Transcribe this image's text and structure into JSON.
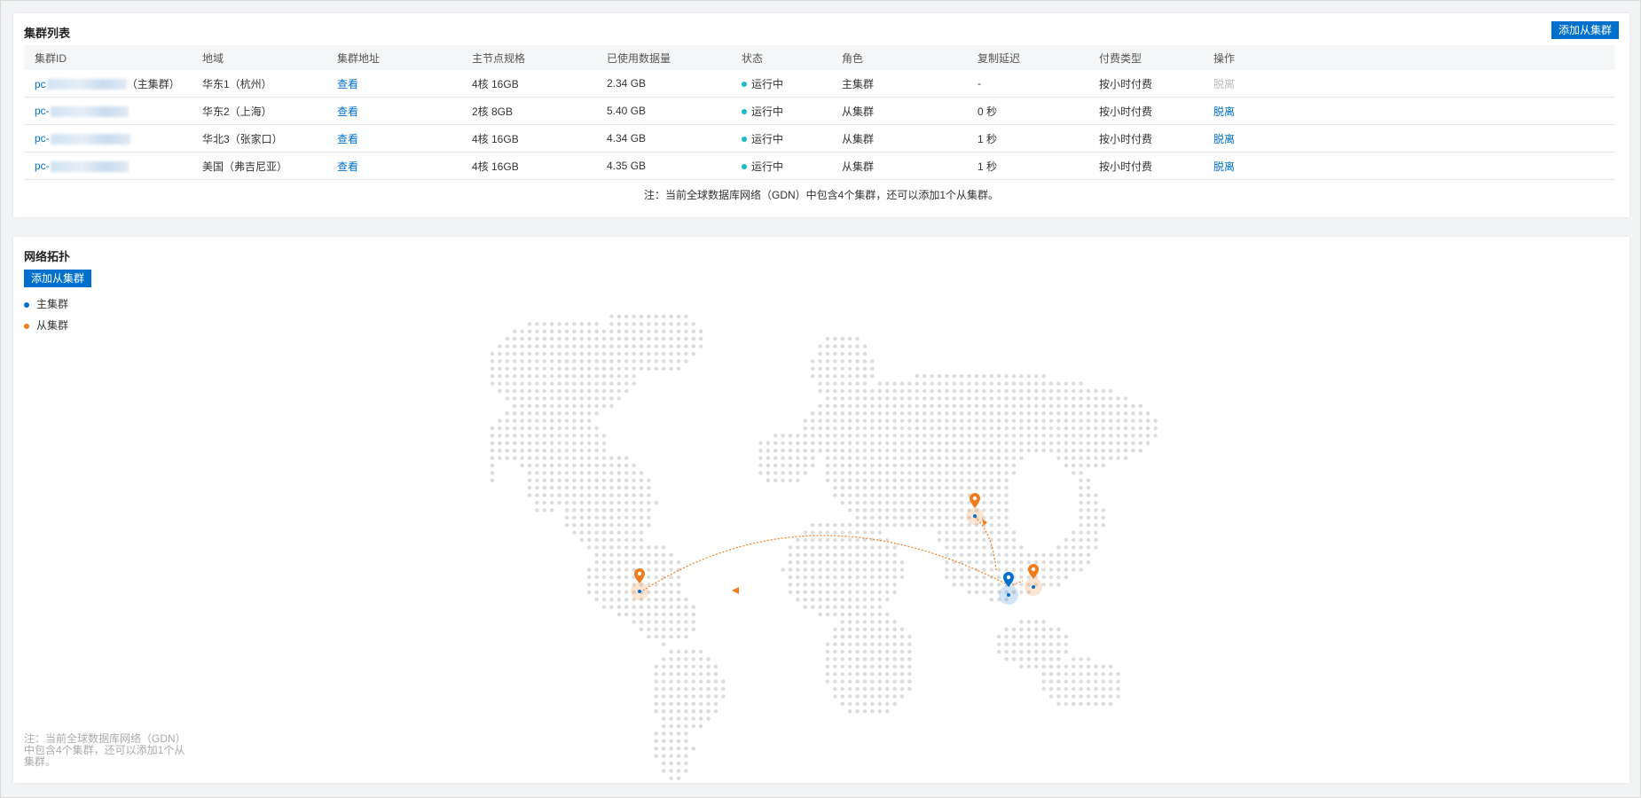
{
  "cluster_list": {
    "title": "集群列表",
    "add_button": "添加从集群",
    "columns": [
      "集群ID",
      "地域",
      "集群地址",
      "主节点规格",
      "已使用数据量",
      "状态",
      "角色",
      "复制延迟",
      "付费类型",
      "操作"
    ],
    "rows": [
      {
        "id_prefix": "pc",
        "id_suffix": "（主集群）",
        "region": "华东1（杭州）",
        "address": "查看",
        "spec": "4核 16GB",
        "data_used": "2.34 GB",
        "status": "运行中",
        "role": "主集群",
        "delay": "-",
        "billing": "按小时付费",
        "action": "脱离",
        "action_enabled": false
      },
      {
        "id_prefix": "pc-",
        "id_suffix": "",
        "region": "华东2（上海）",
        "address": "查看",
        "spec": "2核 8GB",
        "data_used": "5.40 GB",
        "status": "运行中",
        "role": "从集群",
        "delay": "0 秒",
        "billing": "按小时付费",
        "action": "脱离",
        "action_enabled": true
      },
      {
        "id_prefix": "pc-",
        "id_suffix": "",
        "region": "华北3（张家口）",
        "address": "查看",
        "spec": "4核 16GB",
        "data_used": "4.34 GB",
        "status": "运行中",
        "role": "从集群",
        "delay": "1 秒",
        "billing": "按小时付费",
        "action": "脱离",
        "action_enabled": true
      },
      {
        "id_prefix": "pc-",
        "id_suffix": "",
        "region": "美国（弗吉尼亚）",
        "address": "查看",
        "spec": "4核 16GB",
        "data_used": "4.35 GB",
        "status": "运行中",
        "role": "从集群",
        "delay": "1 秒",
        "billing": "按小时付费",
        "action": "脱离",
        "action_enabled": true
      }
    ],
    "note": "注：当前全球数据库网络（GDN）中包含4个集群，还可以添加1个从集群。"
  },
  "topology": {
    "title": "网络拓扑",
    "add_button": "添加从集群",
    "legend": [
      {
        "label": "主集群",
        "color": "#0070cc"
      },
      {
        "label": "从集群",
        "color": "#f07c1e"
      }
    ],
    "note": "注：当前全球数据库网络（GDN）中包含4个集群，还可以添加1个从集群。"
  },
  "colors": {
    "primary": "#0070cc",
    "secondary": "#f07c1e",
    "status_running": "#1eb8c7",
    "map_dot": "#dcdcdc"
  }
}
